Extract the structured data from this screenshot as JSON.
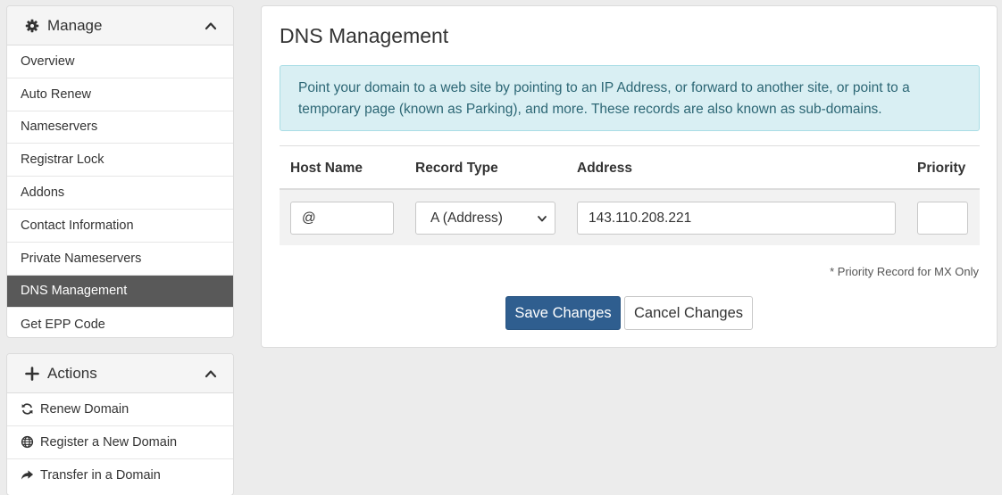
{
  "sidebar": {
    "manage": {
      "title": "Manage",
      "icon": "gear-icon",
      "items": [
        {
          "label": "Overview",
          "active": false
        },
        {
          "label": "Auto Renew",
          "active": false
        },
        {
          "label": "Nameservers",
          "active": false
        },
        {
          "label": "Registrar Lock",
          "active": false
        },
        {
          "label": "Addons",
          "active": false
        },
        {
          "label": "Contact Information",
          "active": false
        },
        {
          "label": "Private Nameservers",
          "active": false
        },
        {
          "label": "DNS Management",
          "active": true
        },
        {
          "label": "Get EPP Code",
          "active": false
        }
      ]
    },
    "actions": {
      "title": "Actions",
      "icon": "plus-icon",
      "items": [
        {
          "label": "Renew Domain",
          "icon": "refresh-icon"
        },
        {
          "label": "Register a New Domain",
          "icon": "globe-icon"
        },
        {
          "label": "Transfer in a Domain",
          "icon": "share-arrow-icon"
        }
      ]
    }
  },
  "main": {
    "title": "DNS Management",
    "info": "Point your domain to a web site by pointing to an IP Address, or forward to another site, or point to a temporary page (known as Parking), and more. These records are also known as sub-domains.",
    "table": {
      "headers": {
        "host": "Host Name",
        "type": "Record Type",
        "address": "Address",
        "priority": "Priority"
      },
      "row": {
        "host": "@",
        "type": "A (Address)",
        "address": "143.110.208.221",
        "priority": ""
      }
    },
    "note": "* Priority Record for MX Only",
    "save_label": "Save Changes",
    "cancel_label": "Cancel Changes"
  },
  "colors": {
    "active_item": "#595959",
    "primary_button": "#2f5e8f",
    "info_background": "#d9eff3",
    "info_text": "#2d6775"
  }
}
